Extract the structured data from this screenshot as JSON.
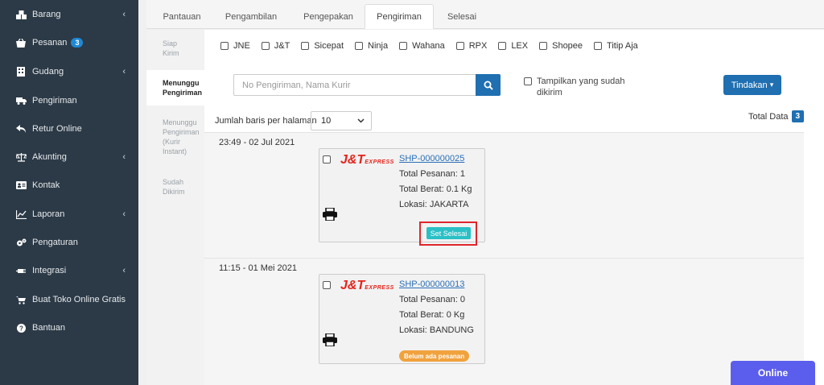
{
  "sidebar": {
    "items": [
      {
        "label": "Barang",
        "icon": "boxes-icon",
        "chevron": true
      },
      {
        "label": "Pesanan",
        "icon": "basket-icon",
        "badge": "3"
      },
      {
        "label": "Gudang",
        "icon": "building-icon",
        "chevron": true
      },
      {
        "label": "Pengiriman",
        "icon": "truck-icon"
      },
      {
        "label": "Retur Online",
        "icon": "reply-icon"
      },
      {
        "label": "Akunting",
        "icon": "balance-scale-icon",
        "chevron": true
      },
      {
        "label": "Kontak",
        "icon": "contact-card-icon"
      },
      {
        "label": "Laporan",
        "icon": "line-chart-icon",
        "chevron": true
      },
      {
        "label": "Pengaturan",
        "icon": "gears-icon"
      },
      {
        "label": "Integrasi",
        "icon": "plug-icon",
        "chevron": true
      },
      {
        "label": "Buat Toko Online Gratis",
        "icon": "cart-icon"
      },
      {
        "label": "Bantuan",
        "icon": "question-circle-icon"
      }
    ]
  },
  "tabs": [
    {
      "label": "Pantauan"
    },
    {
      "label": "Pengambilan"
    },
    {
      "label": "Pengepakan"
    },
    {
      "label": "Pengiriman",
      "active": true
    },
    {
      "label": "Selesai"
    }
  ],
  "status_steps": [
    {
      "line1": "Siap",
      "line2": "Kirim"
    },
    {
      "line1": "Menunggu",
      "line2": "Pengiriman",
      "active": true
    },
    {
      "line1": "Menunggu",
      "line2": "Pengiriman",
      "line3": "(Kurir",
      "line4": "Instant)"
    },
    {
      "line1": "Sudah",
      "line2": "Dikirim"
    }
  ],
  "courier_filters": [
    "JNE",
    "J&T",
    "Sicepat",
    "Ninja",
    "Wahana",
    "RPX",
    "LEX",
    "Shopee",
    "Titip Aja"
  ],
  "search": {
    "placeholder": "No Pengiriman, Nama Kurir"
  },
  "show_sent": {
    "line1": "Tampilkan yang sudah",
    "line2": "dikirim"
  },
  "actions": {
    "tindakan_label": "Tindakan",
    "caret": "▾"
  },
  "pagination": {
    "rows_label": "Jumlah baris per halaman",
    "rows_value": "10",
    "total_label": "Total Data",
    "total_value": "3"
  },
  "shipments": [
    {
      "time": "23:49 - 02 Jul 2021",
      "courier_logo": "J&T",
      "courier_logo_sub": "EXPRESS",
      "shipment_no": "SHP-000000025",
      "total_pesanan": "Total Pesanan: 1",
      "total_berat": "Total Berat: 0.1 Kg",
      "lokasi": "Lokasi: JAKARTA",
      "action_label": "Set Selesai"
    },
    {
      "time": "11:15 - 01 Mei 2021",
      "courier_logo": "J&T",
      "courier_logo_sub": "EXPRESS",
      "shipment_no": "SHP-000000013",
      "total_pesanan": "Total Pesanan: 0",
      "total_berat": "Total Berat: 0 Kg",
      "lokasi": "Lokasi: BANDUNG",
      "status_pill": "Belum ada pesanan"
    }
  ],
  "chat": {
    "label": "Online"
  },
  "colors": {
    "sidebar_bg": "#2c3a47",
    "primary": "#1f6fb1",
    "jt_red": "#e5231b",
    "teal": "#29c0c6",
    "orange": "#f0a23d",
    "highlight_red": "#e0262b",
    "chat_purple": "#5b5ded"
  }
}
